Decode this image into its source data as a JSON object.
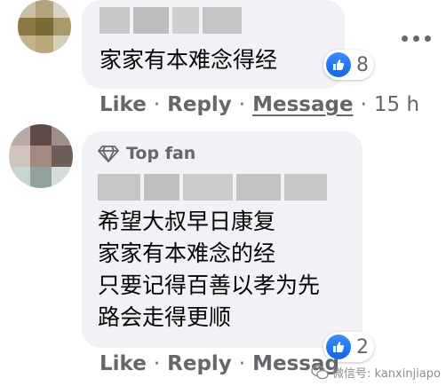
{
  "comment1": {
    "text": "家家有本难念得经",
    "reactions": {
      "count": "8"
    },
    "actions": {
      "like": "Like",
      "reply": "Reply",
      "message": "Message",
      "time": "15 h"
    }
  },
  "comment2": {
    "badge": "Top fan",
    "lines": [
      "希望大叔早日康复",
      "家家有本难念的经",
      "只要记得百善以孝为先",
      "路会走得更顺"
    ],
    "reactions": {
      "count": "2"
    },
    "actions": {
      "like": "Like",
      "reply": "Reply",
      "message": "Messag"
    }
  },
  "separator": "·",
  "watermark": "微信号: kanxinjiapo",
  "colors": {
    "bubble": "#f0f2f5",
    "meta_text": "#65676b",
    "like_blue": "#1877f2"
  },
  "icons": [
    "more-options-icon",
    "thumbs-up-icon",
    "diamond-icon",
    "wechat-icon"
  ]
}
